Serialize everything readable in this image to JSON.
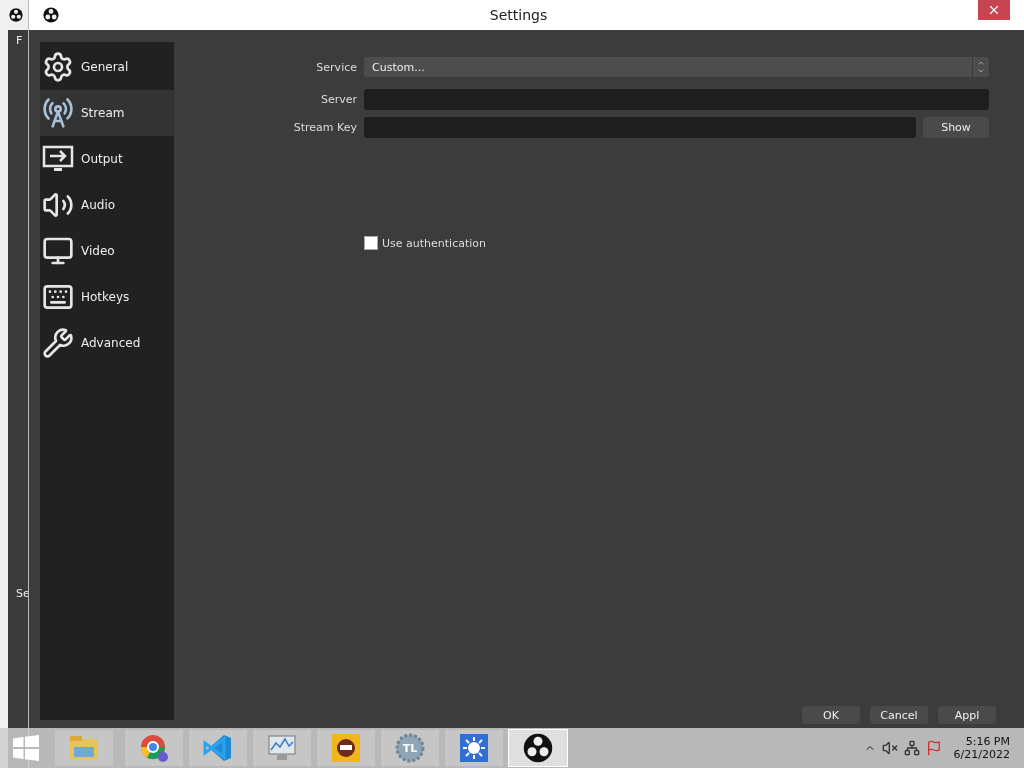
{
  "background_window": {
    "texts": [
      "F",
      "Se"
    ]
  },
  "window": {
    "title": "Settings"
  },
  "sidebar": {
    "items": [
      {
        "label": "General",
        "kind": "gear",
        "selected": false
      },
      {
        "label": "Stream",
        "kind": "antenna",
        "selected": true
      },
      {
        "label": "Output",
        "kind": "output",
        "selected": false
      },
      {
        "label": "Audio",
        "kind": "speaker",
        "selected": false
      },
      {
        "label": "Video",
        "kind": "monitor",
        "selected": false
      },
      {
        "label": "Hotkeys",
        "kind": "keyboard",
        "selected": false
      },
      {
        "label": "Advanced",
        "kind": "tools",
        "selected": false
      }
    ]
  },
  "form": {
    "service": {
      "label": "Service",
      "value": "Custom..."
    },
    "server": {
      "label": "Server"
    },
    "stream_key": {
      "label": "Stream Key",
      "button": "Show"
    },
    "authentication": {
      "label": "Use authentication",
      "checked": false
    }
  },
  "buttons": [
    "OK",
    "Cancel",
    "Appl"
  ],
  "taskbar": {
    "apps": [
      {
        "kind": "folder",
        "selected": false
      },
      {
        "kind": "browser",
        "selected": false
      },
      {
        "kind": "code",
        "selected": false
      },
      {
        "kind": "chart",
        "selected": false
      },
      {
        "kind": "game",
        "selected": false
      },
      {
        "kind": "gear",
        "label": "TL",
        "selected": false
      },
      {
        "kind": "sun",
        "selected": false
      },
      {
        "kind": "obs",
        "selected": true
      }
    ],
    "time": "5:16 PM",
    "date": "6/21/2022"
  }
}
